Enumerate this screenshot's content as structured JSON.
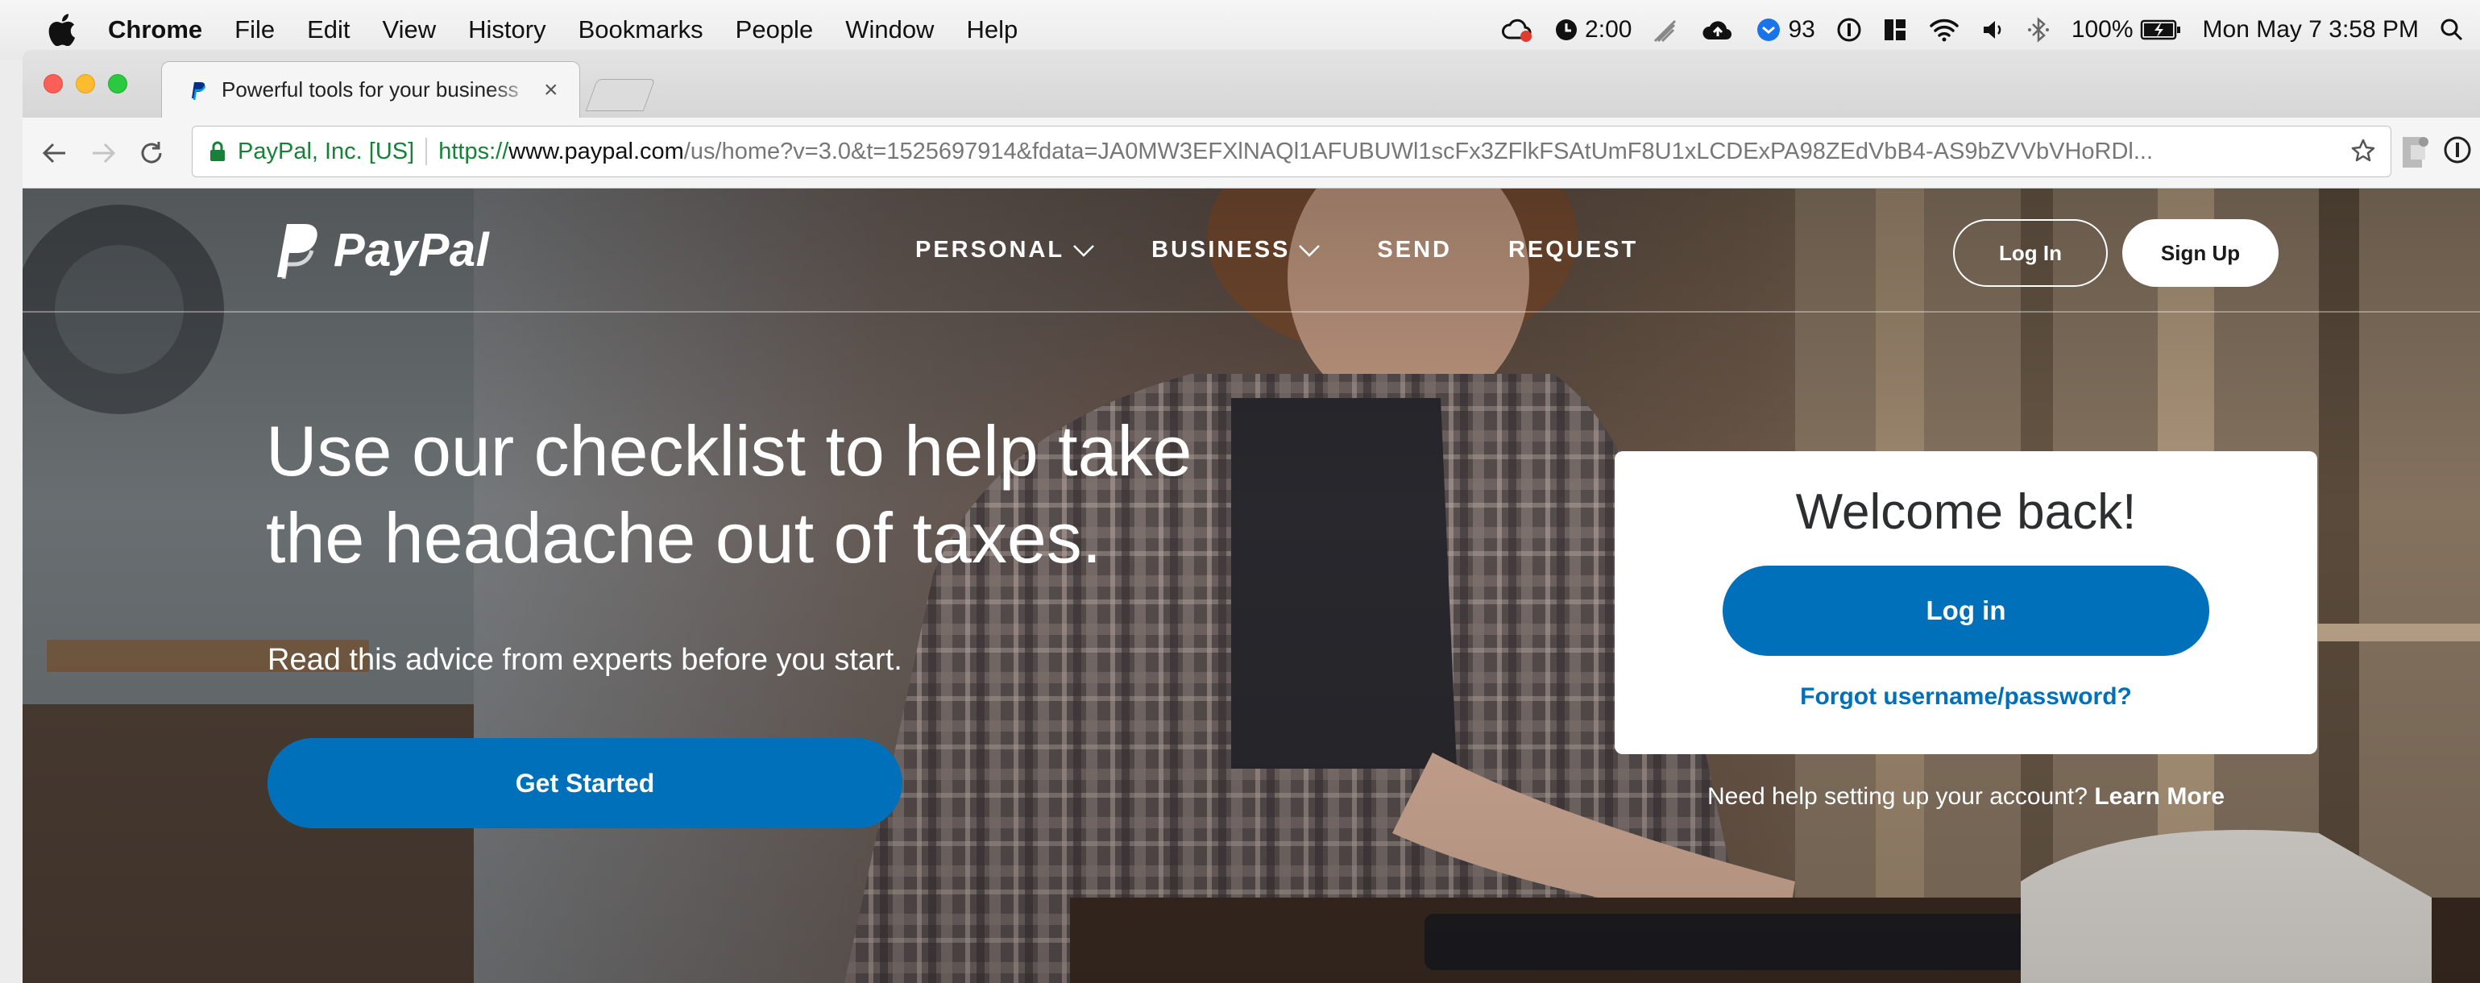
{
  "menubar": {
    "app_name": "Chrome",
    "items": [
      "File",
      "Edit",
      "View",
      "History",
      "Bookmarks",
      "People",
      "Window",
      "Help"
    ],
    "status": {
      "timer": "2:00",
      "badge_count": "93",
      "battery": "100%",
      "datetime": "Mon May 7  3:58 PM"
    }
  },
  "browser": {
    "tab_title": "Powerful tools for your business",
    "tab_close": "×",
    "secure_label": "PayPal, Inc. [US]",
    "url_scheme": "https://",
    "url_host": "www.paypal.com",
    "url_path": "/us/home?v=3.0&t=1525697914&fdata=JA0MW3EFXlNAQl1AFUBUWl1scFx3ZFlkFSAtUmF8U1xLCDExPA98ZEdVbB4-AS9bZVVbVHoRDl..."
  },
  "site": {
    "logo_text": "PayPal",
    "nav": [
      {
        "label": "PERSONAL",
        "has_dropdown": true
      },
      {
        "label": "BUSINESS",
        "has_dropdown": true
      },
      {
        "label": "SEND",
        "has_dropdown": false
      },
      {
        "label": "REQUEST",
        "has_dropdown": false
      }
    ],
    "header_login": "Log In",
    "header_signup": "Sign Up"
  },
  "hero": {
    "title_line1": "Use our checklist to help take",
    "title_line2": "the headache out of taxes.",
    "subtitle": "Read this advice from experts before you start.",
    "cta": "Get Started"
  },
  "login_card": {
    "welcome": "Welcome back!",
    "login_button": "Log in",
    "forgot_link": "Forgot username/password?",
    "help_text": "Need help setting up your account?",
    "learn_more": "Learn More"
  },
  "colors": {
    "brand_blue": "#0070ba",
    "secure_green": "#188038"
  }
}
